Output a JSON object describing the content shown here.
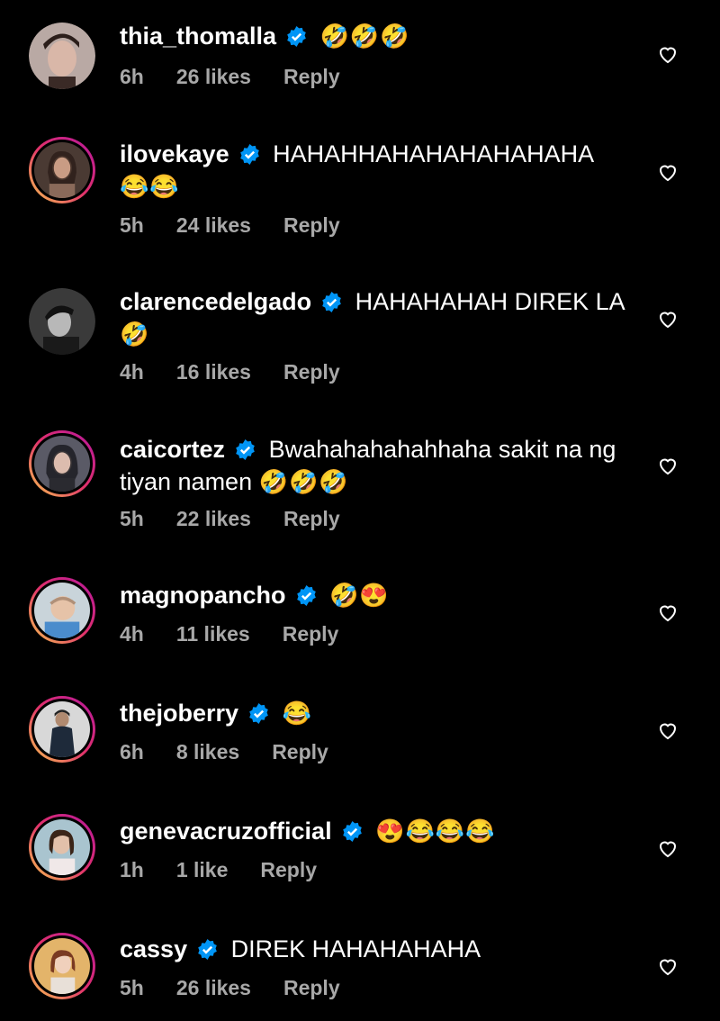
{
  "comments": [
    {
      "username": "thia_thomalla",
      "text": "",
      "emoji": "🤣🤣🤣",
      "time": "6h",
      "likes": "26 likes",
      "reply": "Reply",
      "avatar": "avatar-thia"
    },
    {
      "username": "ilovekaye",
      "text": "HAHAHHAHAHAHAHAHAHA",
      "emoji": "😂😂",
      "time": "5h",
      "likes": "24 likes",
      "reply": "Reply",
      "avatar": "avatar-ilovekaye"
    },
    {
      "username": "clarencedelgado",
      "text": "HAHAHAHAH DIREK LA",
      "emoji": "🤣",
      "time": "4h",
      "likes": "16 likes",
      "reply": "Reply",
      "avatar": "avatar-clarence"
    },
    {
      "username": "caicortez",
      "text": "Bwahahahahahhaha sakit na ng tiyan namen",
      "emoji": "🤣🤣🤣",
      "time": "5h",
      "likes": "22 likes",
      "reply": "Reply",
      "avatar": "avatar-cai"
    },
    {
      "username": "magnopancho",
      "text": "",
      "emoji": "🤣😍",
      "time": "4h",
      "likes": "11 likes",
      "reply": "Reply",
      "avatar": "avatar-magno"
    },
    {
      "username": "thejoberry",
      "text": "",
      "emoji": "😂",
      "time": "6h",
      "likes": "8 likes",
      "reply": "Reply",
      "avatar": "avatar-joberry"
    },
    {
      "username": "genevacruzofficial",
      "text": "",
      "emoji": "😍😂😂😂",
      "time": "1h",
      "likes": "1 like",
      "reply": "Reply",
      "avatar": "avatar-geneva"
    },
    {
      "username": "cassy",
      "text": "DIREK HAHAHAHAHA",
      "emoji": "",
      "time": "5h",
      "likes": "26 likes",
      "reply": "Reply",
      "avatar": "avatar-cassy"
    }
  ],
  "colors": {
    "verified": "#0095f6",
    "meta": "#a8a8a8",
    "background": "#000000"
  }
}
